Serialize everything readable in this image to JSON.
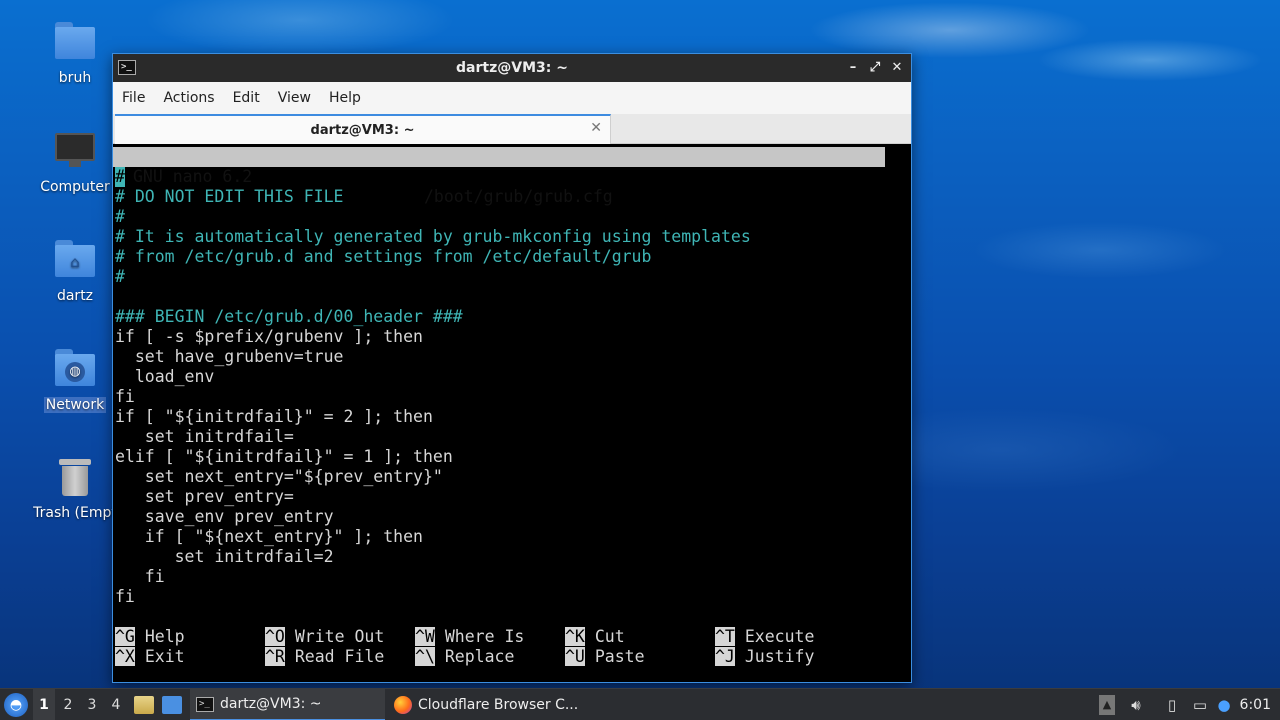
{
  "desktop": {
    "icons": [
      {
        "label": "bruh"
      },
      {
        "label": "Computer"
      },
      {
        "label": "dartz"
      },
      {
        "label": "Network"
      },
      {
        "label": "Trash (Empt"
      }
    ]
  },
  "window": {
    "title": "dartz@VM3: ~",
    "controls": {
      "minimize": "–",
      "maximize": "⤢",
      "close": "✕"
    },
    "menu": [
      "File",
      "Actions",
      "Edit",
      "View",
      "Help"
    ],
    "tab": {
      "label": "dartz@VM3: ~",
      "close": "✕"
    }
  },
  "nano": {
    "version": "GNU nano 6.2",
    "filename": "/boot/grub/grub.cfg",
    "lines": [
      {
        "text": "#",
        "type": "cursor"
      },
      {
        "text": "# DO NOT EDIT THIS FILE",
        "type": "comment"
      },
      {
        "text": "#",
        "type": "comment"
      },
      {
        "text": "# It is automatically generated by grub-mkconfig using templates",
        "type": "comment"
      },
      {
        "text": "# from /etc/grub.d and settings from /etc/default/grub",
        "type": "comment"
      },
      {
        "text": "#",
        "type": "comment"
      },
      {
        "text": "",
        "type": "code"
      },
      {
        "text": "### BEGIN /etc/grub.d/00_header ###",
        "type": "comment"
      },
      {
        "text": "if [ -s $prefix/grubenv ]; then",
        "type": "code"
      },
      {
        "text": "  set have_grubenv=true",
        "type": "code"
      },
      {
        "text": "  load_env",
        "type": "code"
      },
      {
        "text": "fi",
        "type": "code"
      },
      {
        "text": "if [ \"${initrdfail}\" = 2 ]; then",
        "type": "code"
      },
      {
        "text": "   set initrdfail=",
        "type": "code"
      },
      {
        "text": "elif [ \"${initrdfail}\" = 1 ]; then",
        "type": "code"
      },
      {
        "text": "   set next_entry=\"${prev_entry}\"",
        "type": "code"
      },
      {
        "text": "   set prev_entry=",
        "type": "code"
      },
      {
        "text": "   save_env prev_entry",
        "type": "code"
      },
      {
        "text": "   if [ \"${next_entry}\" ]; then",
        "type": "code"
      },
      {
        "text": "      set initrdfail=2",
        "type": "code"
      },
      {
        "text": "   fi",
        "type": "code"
      },
      {
        "text": "fi",
        "type": "code"
      }
    ],
    "shortcuts": [
      [
        {
          "key": "^G",
          "label": "Help"
        },
        {
          "key": "^O",
          "label": "Write Out"
        },
        {
          "key": "^W",
          "label": "Where Is"
        },
        {
          "key": "^K",
          "label": "Cut"
        },
        {
          "key": "^T",
          "label": "Execute"
        }
      ],
      [
        {
          "key": "^X",
          "label": "Exit"
        },
        {
          "key": "^R",
          "label": "Read File"
        },
        {
          "key": "^\\",
          "label": "Replace"
        },
        {
          "key": "^U",
          "label": "Paste"
        },
        {
          "key": "^J",
          "label": "Justify"
        }
      ]
    ]
  },
  "taskbar": {
    "workspaces": [
      "1",
      "2",
      "3",
      "4"
    ],
    "tasks": [
      {
        "label": "dartz@VM3: ~",
        "icon": "terminal-icon"
      },
      {
        "label": "Cloudflare Browser C...",
        "icon": "firefox-icon"
      }
    ],
    "clock": "6:01"
  }
}
